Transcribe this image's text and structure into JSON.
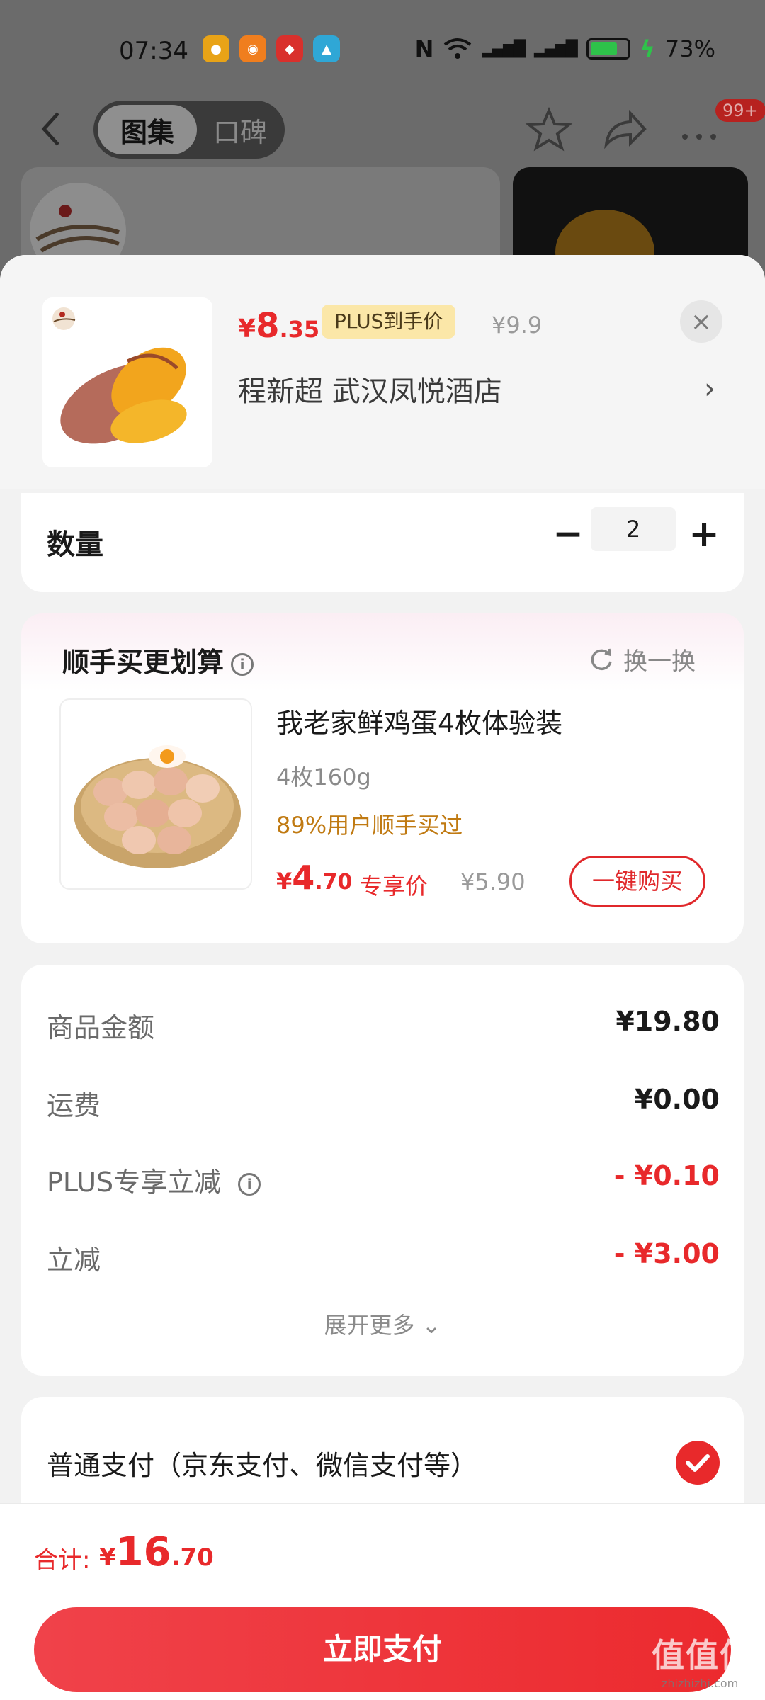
{
  "status_bar": {
    "time": "07:34",
    "battery": "73%",
    "battery_level": 0.73
  },
  "top_nav": {
    "tab_active": "图集",
    "tab_inactive": "口碑",
    "badge": "99+"
  },
  "product": {
    "price_yen": "¥",
    "price_int": "8",
    "price_dec": ".35",
    "plus_tag": "PLUS到手价",
    "original_price": "¥9.9",
    "address": "程新超  武汉凤悦酒店",
    "close": "×",
    "chevron": "›"
  },
  "quantity": {
    "label": "数量",
    "minus": "−",
    "value": "2",
    "plus": "+"
  },
  "upsell": {
    "title": "顺手买更划算",
    "info": "i",
    "refresh": "换一换",
    "item_name": "我老家鲜鸡蛋4枚体验装",
    "item_spec": "4枚160g",
    "item_social": "89%用户顺手买过",
    "price_yen": "¥",
    "price_int": "4",
    "price_dec": ".70",
    "exclusive": "专享价",
    "original_price": "¥5.90",
    "buy_button": "一键购买"
  },
  "summary": {
    "rows": [
      {
        "label": "商品金额",
        "value": "¥19.80"
      },
      {
        "label": "运费",
        "value": "¥0.00"
      },
      {
        "label": "PLUS专享立减",
        "value": "- ¥0.10"
      },
      {
        "label": "立减",
        "value": "- ¥3.00"
      }
    ],
    "expand": "展开更多 ⌄"
  },
  "payment": {
    "method": "普通支付（京东支付、微信支付等）"
  },
  "bottom": {
    "total_label": "合计:",
    "total_yen": "¥",
    "total_int": "16",
    "total_dec": ".70",
    "pay_button": "立即支付"
  },
  "watermark": {
    "logo": "值值值",
    "site": "zhizhizhi.com"
  },
  "colors": {
    "accent_red": "#e8292b",
    "plus_gold": "#fbe7a8",
    "social_orange": "#c07a12"
  }
}
